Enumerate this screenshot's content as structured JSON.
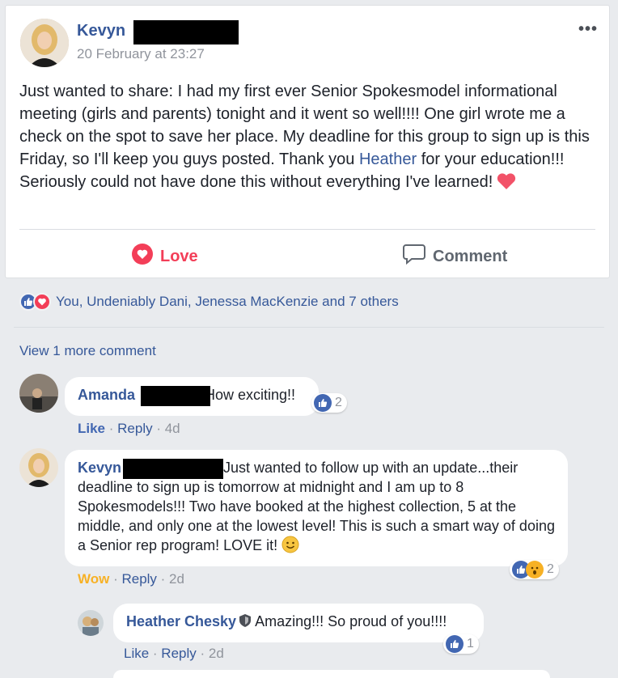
{
  "post": {
    "author": "Kevyn",
    "timestamp": "20 February at 23:27",
    "more": "•••",
    "text_part1": "Just wanted to share: I had my first ever Senior Spokesmodel informational meeting (girls and parents) tonight and it went so well!!!! One girl wrote me a check on the spot to save her place. My deadline for this group to sign up is this Friday, so I'll keep you guys posted. Thank you ",
    "mention": "Heather",
    "text_part2": " for your education!!! Seriously could not have done this without everything I've learned!",
    "love_label": "Love",
    "comment_label": "Comment"
  },
  "reactions": {
    "summary": "You, Undeniably Dani, Jenessa MacKenzie and 7 others"
  },
  "view_more": "View 1 more comment",
  "comments": [
    {
      "name": "Amanda",
      "text": "How exciting!!",
      "like": "Like",
      "reply": "Reply",
      "time": "4d",
      "reaction_count": "2"
    },
    {
      "name": "Kevyn",
      "text": "Just wanted to follow up with an update...their deadline to sign up is tomorrow at midnight and I am up to 8 Spokesmodels!!! Two have booked at the highest collection, 5 at the middle, and only one at the lowest level! This is such a smart way of doing a Senior rep program! LOVE it!",
      "wow": "Wow",
      "reply": "Reply",
      "time": "2d",
      "reaction_count": "2"
    },
    {
      "name": "Heather Chesky",
      "text": "Amazing!!! So proud of you!!!!",
      "like": "Like",
      "reply": "Reply",
      "time": "2d",
      "reaction_count": "1"
    }
  ],
  "colors": {
    "link": "#365899",
    "love": "#f33e58",
    "like": "#4267b2",
    "wow": "#f7b125",
    "background": "#e9ebee"
  }
}
